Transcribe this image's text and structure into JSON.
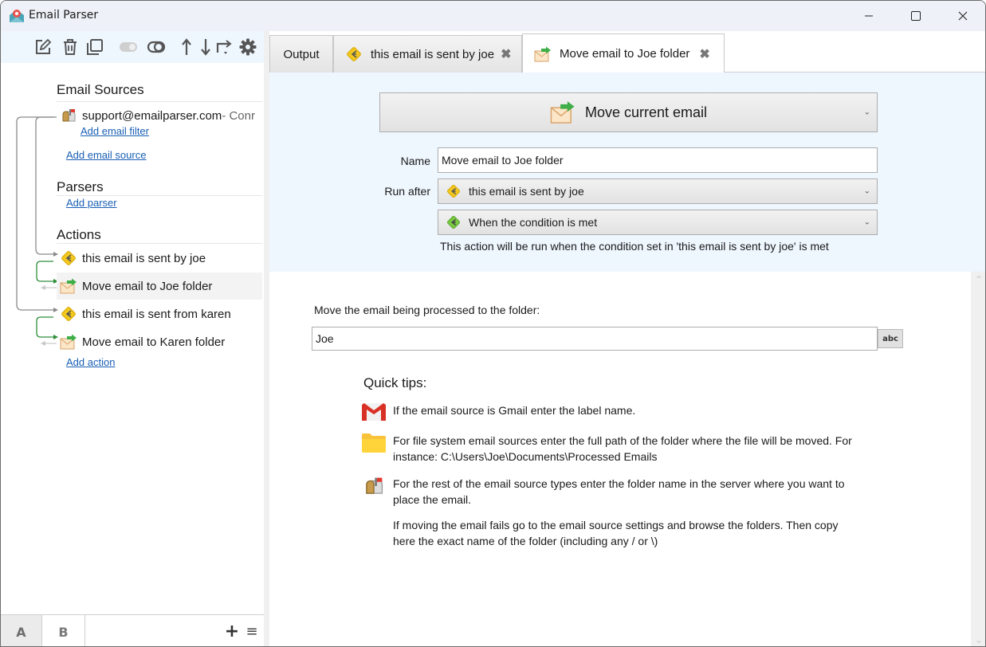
{
  "window": {
    "title": "Email Parser",
    "controls": {
      "minimize": "minimize",
      "maximize": "maximize",
      "close": "close"
    }
  },
  "sidebar": {
    "toolbar": [
      {
        "name": "edit",
        "icon": "edit-icon"
      },
      {
        "name": "delete",
        "icon": "trash-icon"
      },
      {
        "name": "duplicate",
        "icon": "copy-icon"
      },
      {
        "name": "toggle-enabled",
        "icon": "toggle-off-icon",
        "disabled": true
      },
      {
        "name": "toggle-link",
        "icon": "link-toggle-icon"
      },
      {
        "name": "move-up",
        "icon": "arrow-up-icon"
      },
      {
        "name": "move-down",
        "icon": "arrow-down-icon"
      },
      {
        "name": "redirect",
        "icon": "redirect-icon"
      },
      {
        "name": "settings",
        "icon": "gear-icon"
      }
    ],
    "sections": {
      "email_sources": {
        "title": "Email Sources",
        "items": [
          {
            "label": "support@emailparser.com",
            "suffix": " - Conr"
          }
        ],
        "add_filter": "Add email filter",
        "add_source": "Add email source"
      },
      "parsers": {
        "title": "Parsers",
        "add_parser": "Add parser"
      },
      "actions": {
        "title": "Actions",
        "items": [
          {
            "label": "this email is sent by joe",
            "type": "condition"
          },
          {
            "label": "Move email to Joe folder",
            "type": "move",
            "selected": true
          },
          {
            "label": "this email is sent from karen",
            "type": "condition"
          },
          {
            "label": "Move email to Karen folder",
            "type": "move"
          }
        ],
        "add_action": "Add action"
      }
    },
    "bottom_tabs": [
      {
        "label": "A",
        "active": true
      },
      {
        "label": "B",
        "active": false
      }
    ],
    "bottom_add": "+",
    "bottom_menu": "≡"
  },
  "tabs": [
    {
      "label": "Output",
      "closable": false,
      "active": false
    },
    {
      "label": "this email is sent by joe",
      "closable": true,
      "active": false,
      "icon": "condition-icon"
    },
    {
      "label": "Move email to Joe folder",
      "closable": true,
      "active": true,
      "icon": "move-email-icon"
    }
  ],
  "tab_close_glyph": "✖",
  "editor": {
    "action_type": "Move current email",
    "name_label": "Name",
    "name_value": "Move email to Joe folder",
    "run_after_label": "Run after",
    "run_after_value": "this email is sent by joe",
    "condition_value": "When the condition is met",
    "helper_text": "This action will be run when the condition set in 'this email is sent by joe' is met",
    "folder_label": "Move the email being processed to the folder:",
    "folder_value": "Joe",
    "abc_button": "abc",
    "quick_tips_title": "Quick tips:",
    "tips": [
      {
        "icon": "gmail-icon",
        "text": "If the email source is Gmail enter the label name."
      },
      {
        "icon": "folder-icon",
        "text": "For file system email sources enter the full path of the folder where the file will be moved. For instance: C:\\Users\\Joe\\Documents\\Processed Emails"
      },
      {
        "icon": "mailbox-icon",
        "text": "For the rest of the email source types enter the folder name in the server where you want to place the email."
      },
      {
        "icon": "",
        "text": "If moving the email fails go to the email source settings and browse the folders. Then copy here the exact name of the folder (including any / or \\)"
      }
    ]
  },
  "colors": {
    "accent_link": "#1a5fb4",
    "panel_bg": "#eef6fe",
    "condition_yellow": "#f2c81e",
    "condition_green": "#7ac943",
    "flow_green": "#2f8f3a"
  }
}
